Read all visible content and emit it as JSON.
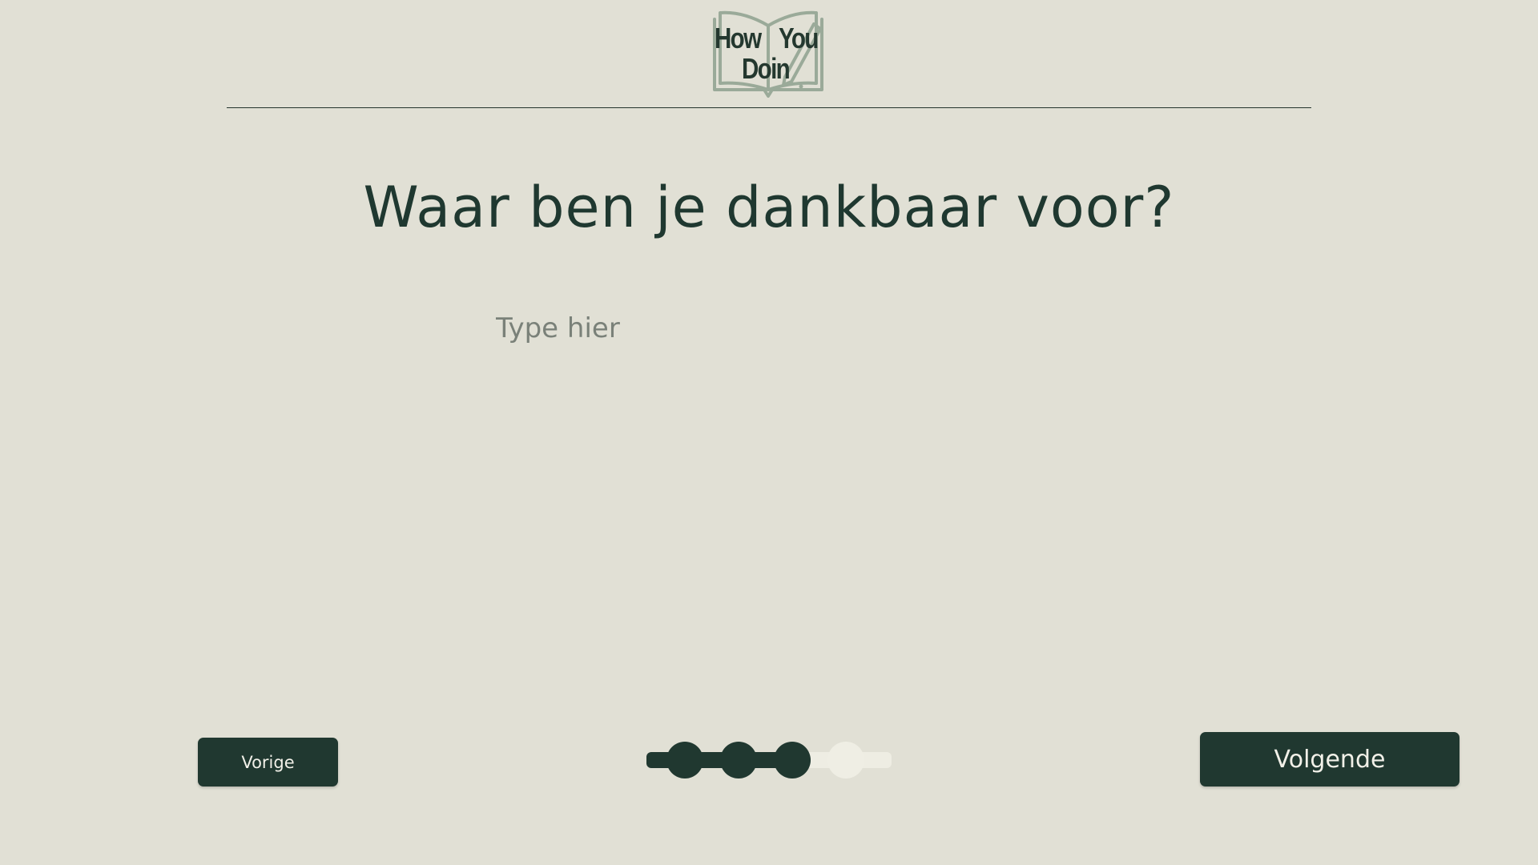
{
  "logo": {
    "line1_left": "How",
    "line1_right": "You",
    "line2": "Doin"
  },
  "question": {
    "title": "Waar ben je dankbaar voor?"
  },
  "answer": {
    "value": "",
    "placeholder": "Type hier"
  },
  "navigation": {
    "prev_label": "Vorige",
    "next_label": "Volgende"
  },
  "progress": {
    "total_steps": 4,
    "completed_steps": 3,
    "fraction": 0.67
  },
  "colors": {
    "background": "#e1e0d5",
    "primary": "#203830",
    "logo_outline": "#9aaa99",
    "step_pending": "#efeee4"
  }
}
